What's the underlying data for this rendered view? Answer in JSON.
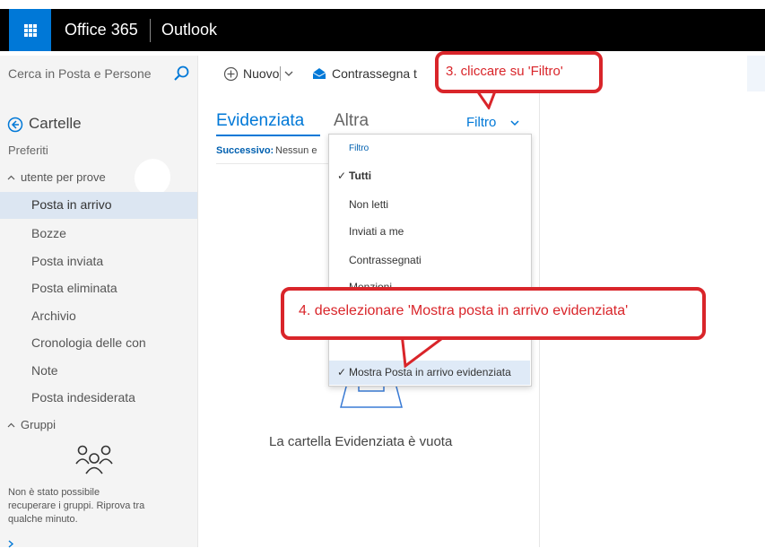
{
  "header": {
    "brand": "Office 365",
    "app": "Outlook"
  },
  "search": {
    "placeholder": "Cerca in Posta e Persone"
  },
  "toolbar": {
    "new_label": "Nuovo",
    "flag_label": "Contrassegna t"
  },
  "sidebar": {
    "folders_title": "Cartelle",
    "favorites": "Preferiti",
    "account": "utente per prove",
    "items": [
      "Posta in arrivo",
      "Bozze",
      "Posta inviata",
      "Posta eliminata",
      "Archivio",
      "Cronologia delle con",
      "Note",
      "Posta indesiderata"
    ],
    "groups_title": "Gruppi",
    "groups_error": [
      "Non è stato possibile",
      "recuperare i gruppi. Riprova tra",
      "qualche minuto."
    ]
  },
  "list": {
    "tab_focused": "Evidenziata",
    "tab_other": "Altra",
    "filter_label": "Filtro",
    "next_label": "Successivo:",
    "next_value": "Nessun e",
    "empty_message": "La cartella Evidenziata è vuota"
  },
  "filter_menu": {
    "header": "Filtro",
    "items": [
      "Tutti",
      "Non letti",
      "Inviati a me",
      "Contrassegnati",
      "Menzioni"
    ],
    "focused_toggle": "Mostra Posta in arrivo evidenziata",
    "checkmark": "✓"
  },
  "annotations": {
    "step3": "3. cliccare su 'Filtro'",
    "step4": "4. deselezionare 'Mostra posta in arrivo evidenziata'"
  },
  "colors": {
    "accent": "#0078d7",
    "annotation_red": "#d9252a",
    "selected_bg": "#dce6f2"
  }
}
